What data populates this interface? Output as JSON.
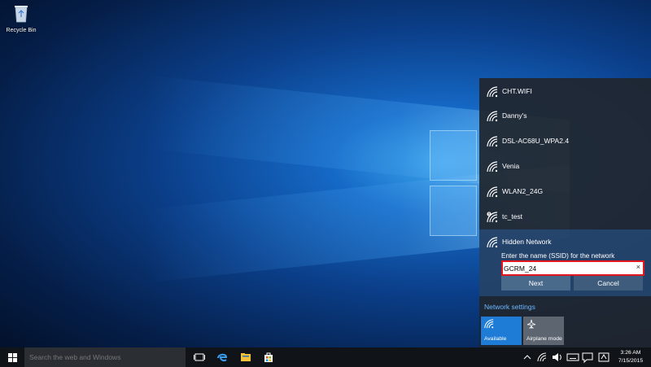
{
  "desktop": {
    "icons": [
      {
        "label": "Recycle Bin",
        "icon": "recycle-bin-icon"
      }
    ]
  },
  "network_flyout": {
    "networks": [
      {
        "name": "CHT.WIFI",
        "icon": "wifi-icon"
      },
      {
        "name": "Danny's",
        "icon": "wifi-icon"
      },
      {
        "name": "DSL-AC68U_WPA2.4",
        "icon": "wifi-icon"
      },
      {
        "name": "Venia",
        "icon": "wifi-icon"
      },
      {
        "name": "WLAN2_24G",
        "icon": "wifi-icon"
      },
      {
        "name": "tc_test",
        "icon": "wifi-unsecured-icon"
      }
    ],
    "hidden": {
      "name": "Hidden Network",
      "prompt": "Enter the name (SSID) for the network",
      "ssid_value": "GCRM_24",
      "clear_glyph": "×",
      "next_label": "Next",
      "cancel_label": "Cancel"
    },
    "settings_link": "Network settings",
    "tiles": [
      {
        "label": "Available",
        "icon": "wifi-icon",
        "active": true
      },
      {
        "label": "Airplane mode",
        "icon": "airplane-icon",
        "active": false
      }
    ]
  },
  "taskbar": {
    "search_placeholder": "Search the web and Windows",
    "pinned": [
      "task-view-icon",
      "edge-icon",
      "file-explorer-icon",
      "store-icon"
    ],
    "tray": [
      "chevron-up-icon",
      "network-icon",
      "volume-icon",
      "keyboard-icon",
      "action-center-icon"
    ],
    "time": "3:26 AM",
    "date": "7/15/2015"
  },
  "colors": {
    "accent": "#1e7cd6",
    "highlight": "#e3161f",
    "panel": "#20262e"
  }
}
